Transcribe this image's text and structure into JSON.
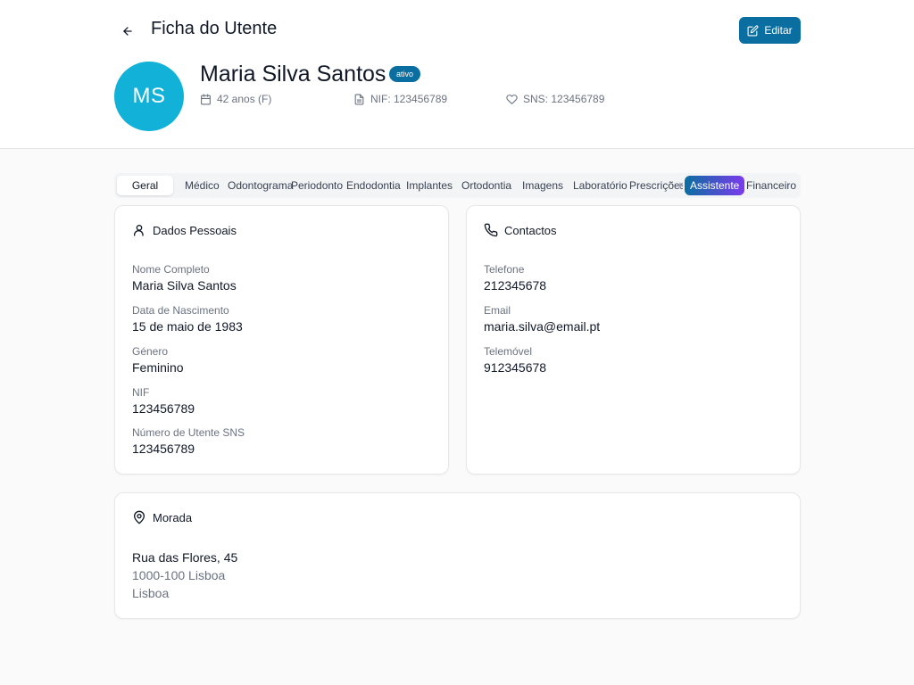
{
  "header": {
    "title": "Ficha do Utente",
    "edit_label": "Editar"
  },
  "patient": {
    "initials": "MS",
    "name": "Maria Silva Santos",
    "status": "ativo",
    "age": "42 anos (F)",
    "nif": "NIF: 123456789",
    "sns": "SNS: 123456789"
  },
  "tabs": [
    {
      "label": "Geral"
    },
    {
      "label": "Médico"
    },
    {
      "label": "Odontograma"
    },
    {
      "label": "Periodonto"
    },
    {
      "label": "Endodontia"
    },
    {
      "label": "Implantes"
    },
    {
      "label": "Ortodontia"
    },
    {
      "label": "Imagens"
    },
    {
      "label": "Laboratório"
    },
    {
      "label": "Prescrições"
    },
    {
      "label": "Assistente"
    },
    {
      "label": "Financeiro"
    }
  ],
  "active_tab": "Geral",
  "personal": {
    "title": "Dados Pessoais",
    "fields": [
      {
        "label": "Nome Completo",
        "value": "Maria Silva Santos"
      },
      {
        "label": "Data de Nascimento",
        "value": "15 de maio de 1983"
      },
      {
        "label": "Género",
        "value": "Feminino"
      },
      {
        "label": "NIF",
        "value": "123456789"
      },
      {
        "label": "Número de Utente SNS",
        "value": "123456789"
      }
    ]
  },
  "contacts": {
    "title": "Contactos",
    "fields": [
      {
        "label": "Telefone",
        "value": "212345678"
      },
      {
        "label": "Email",
        "value": "maria.silva@email.pt"
      },
      {
        "label": "Telemóvel",
        "value": "912345678"
      }
    ]
  },
  "address": {
    "title": "Morada",
    "street": "Rua das Flores, 45",
    "postal": "1000-100 Lisboa",
    "city": "Lisboa"
  },
  "colors": {
    "primary": "#0a6fa0",
    "avatar": "#12b1d8",
    "assistant_gradient_end": "#7c3aed"
  },
  "icons": [
    "arrow-left-icon",
    "edit-icon",
    "calendar-icon",
    "file-icon",
    "heart-icon",
    "user-icon",
    "phone-icon",
    "map-pin-icon",
    "sparkle-icon"
  ]
}
